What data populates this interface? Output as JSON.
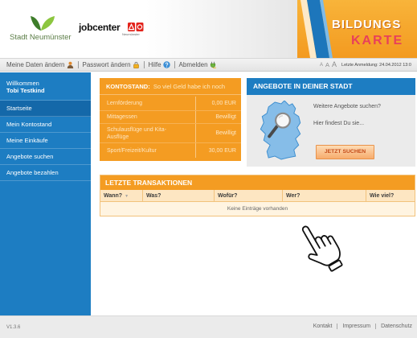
{
  "header": {
    "city_logo_text": "Stadt Neumünster",
    "jobcenter_logo_text": "jobcenter",
    "jobcenter_sub": "Neumünster",
    "brand_line1": "BILDUNGS",
    "brand_line2": "KARTE"
  },
  "topnav": {
    "items": [
      {
        "label": "Meine Daten ändern",
        "icon": "user-icon"
      },
      {
        "label": "Passwort ändern",
        "icon": "lock-icon"
      },
      {
        "label": "Hilfe",
        "icon": "help-icon"
      },
      {
        "label": "Abmelden",
        "icon": "logout-icon"
      }
    ],
    "font_sizes": [
      "A",
      "A",
      "A"
    ],
    "last_login": "Letzte Anmeldung: 24.04.2012 13:0"
  },
  "sidebar": {
    "welcome": "Willkommen",
    "username": "Tobi Testkind",
    "items": [
      {
        "label": "Startseite",
        "active": true
      },
      {
        "label": "Mein Kontostand",
        "active": false
      },
      {
        "label": "Meine Einkäufe",
        "active": false
      },
      {
        "label": "Angebote suchen",
        "active": false
      },
      {
        "label": "Angebote bezahlen",
        "active": false
      }
    ]
  },
  "balance": {
    "title": "KONTOSTAND:",
    "subtitle": "So viel Geld habe ich noch",
    "rows": [
      {
        "label": "Lernförderung",
        "value": "0,00 EUR"
      },
      {
        "label": "Mittagessen",
        "value": "Bewilligt"
      },
      {
        "label": "Schulausflüge und Kita-Ausflüge",
        "value": "Bewilligt"
      },
      {
        "label": "Sport/Freizeit/Kultur",
        "value": "30,00 EUR"
      }
    ]
  },
  "offers": {
    "title": "ANGEBOTE IN DEINER STADT",
    "question": "Weitere Angebote suchen?",
    "hint": "Hier findest Du sie...",
    "button": "JETZT SUCHEN",
    "icon": "germany-map-magnifier-icon"
  },
  "transactions": {
    "title": "LETZTE TRANSAKTIONEN",
    "columns": [
      "Wann?",
      "Was?",
      "Wofür?",
      "Wer?",
      "Wie viel?"
    ],
    "sort_indicator": "▼",
    "empty_message": "Keine Einträge vorhanden"
  },
  "illustration": {
    "icon": "hand-cursor-icon"
  },
  "footer": {
    "version": "V1.3.6",
    "links": [
      "Kontakt",
      "Impressum",
      "Datenschutz"
    ]
  },
  "colors": {
    "brand_blue": "#1d7dc2",
    "brand_blue_active": "#1468a9",
    "orange": "#f49c22",
    "brand_pink": "#e8405a",
    "button_text": "#c44a16"
  }
}
